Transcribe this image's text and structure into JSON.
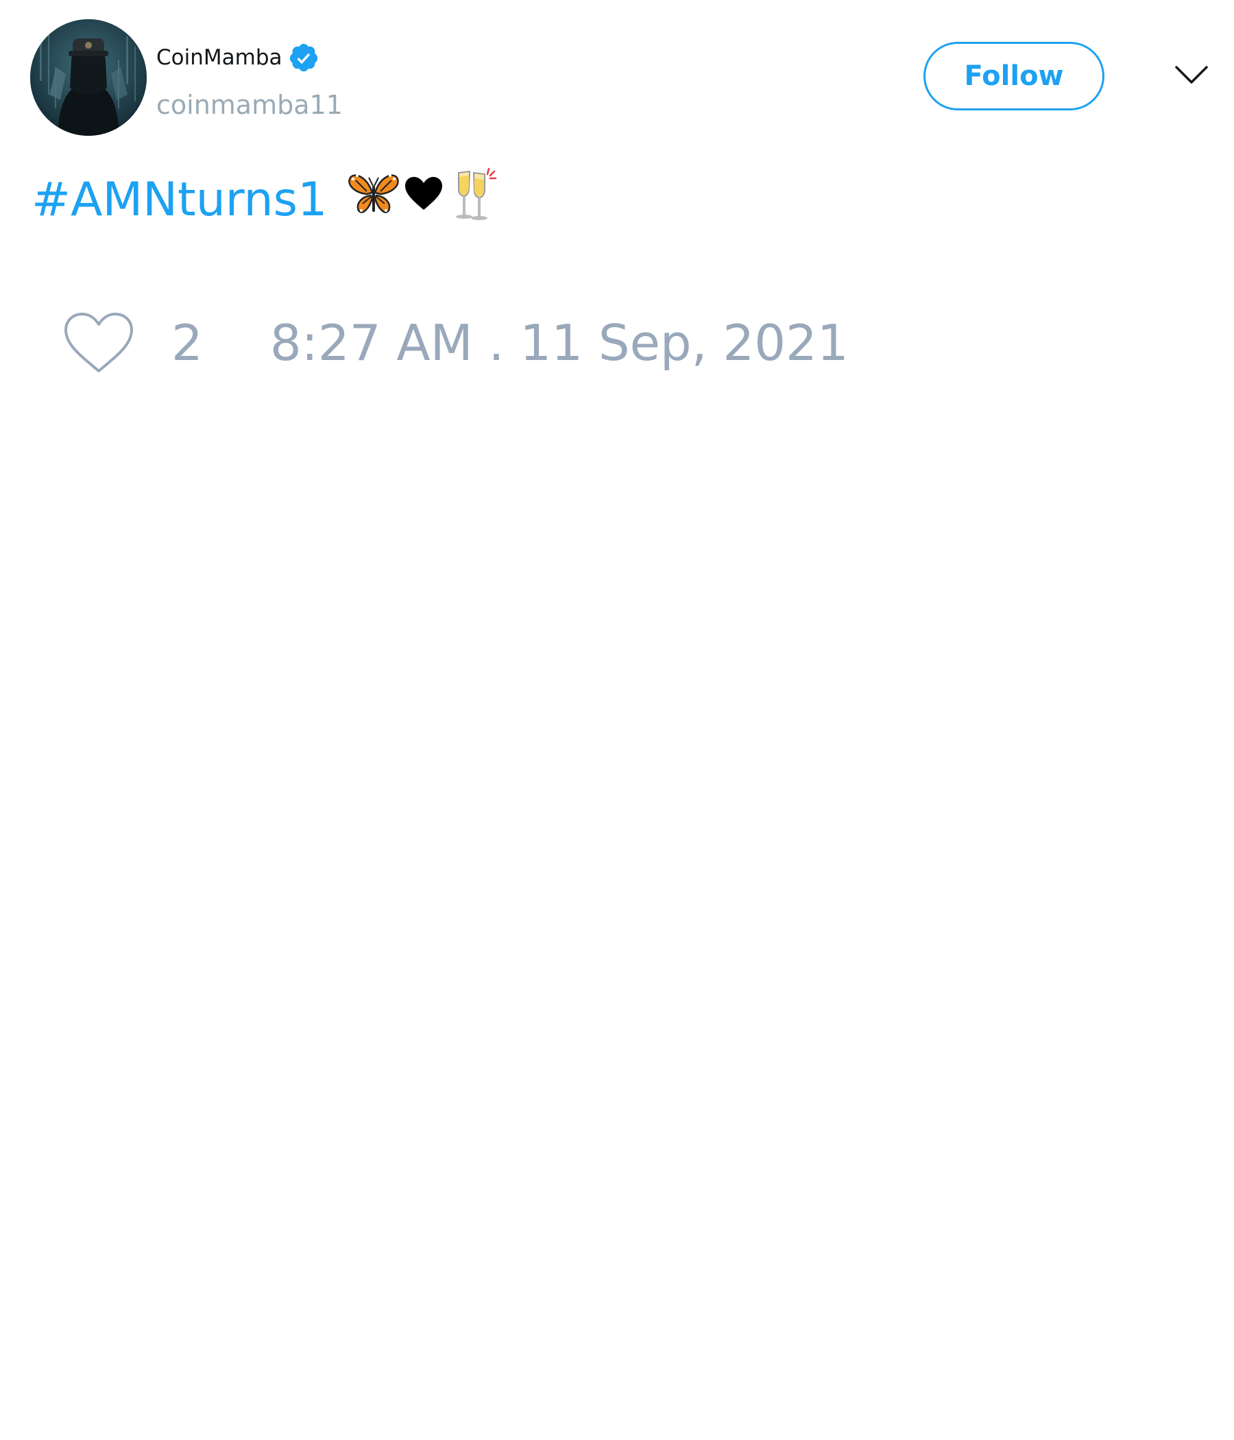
{
  "tweet": {
    "author": {
      "display_name": "CoinMamba",
      "username": "coinmamba11",
      "verified": true,
      "avatar_icon": "avatar-hooded-figure"
    },
    "follow_label": "Follow",
    "menu_icon": "chevron-down-icon",
    "text": {
      "hashtag": "#AMNturns1",
      "emojis": [
        "butterfly-emoji",
        "black-heart-emoji",
        "clinking-glasses-emoji"
      ]
    },
    "likes": {
      "icon": "heart-icon",
      "count": "2"
    },
    "timestamp": "8:27 AM . 11 Sep, 2021"
  },
  "colors": {
    "accent": "#1da1f2",
    "muted": "#99a8ba",
    "name": "#14171a"
  }
}
